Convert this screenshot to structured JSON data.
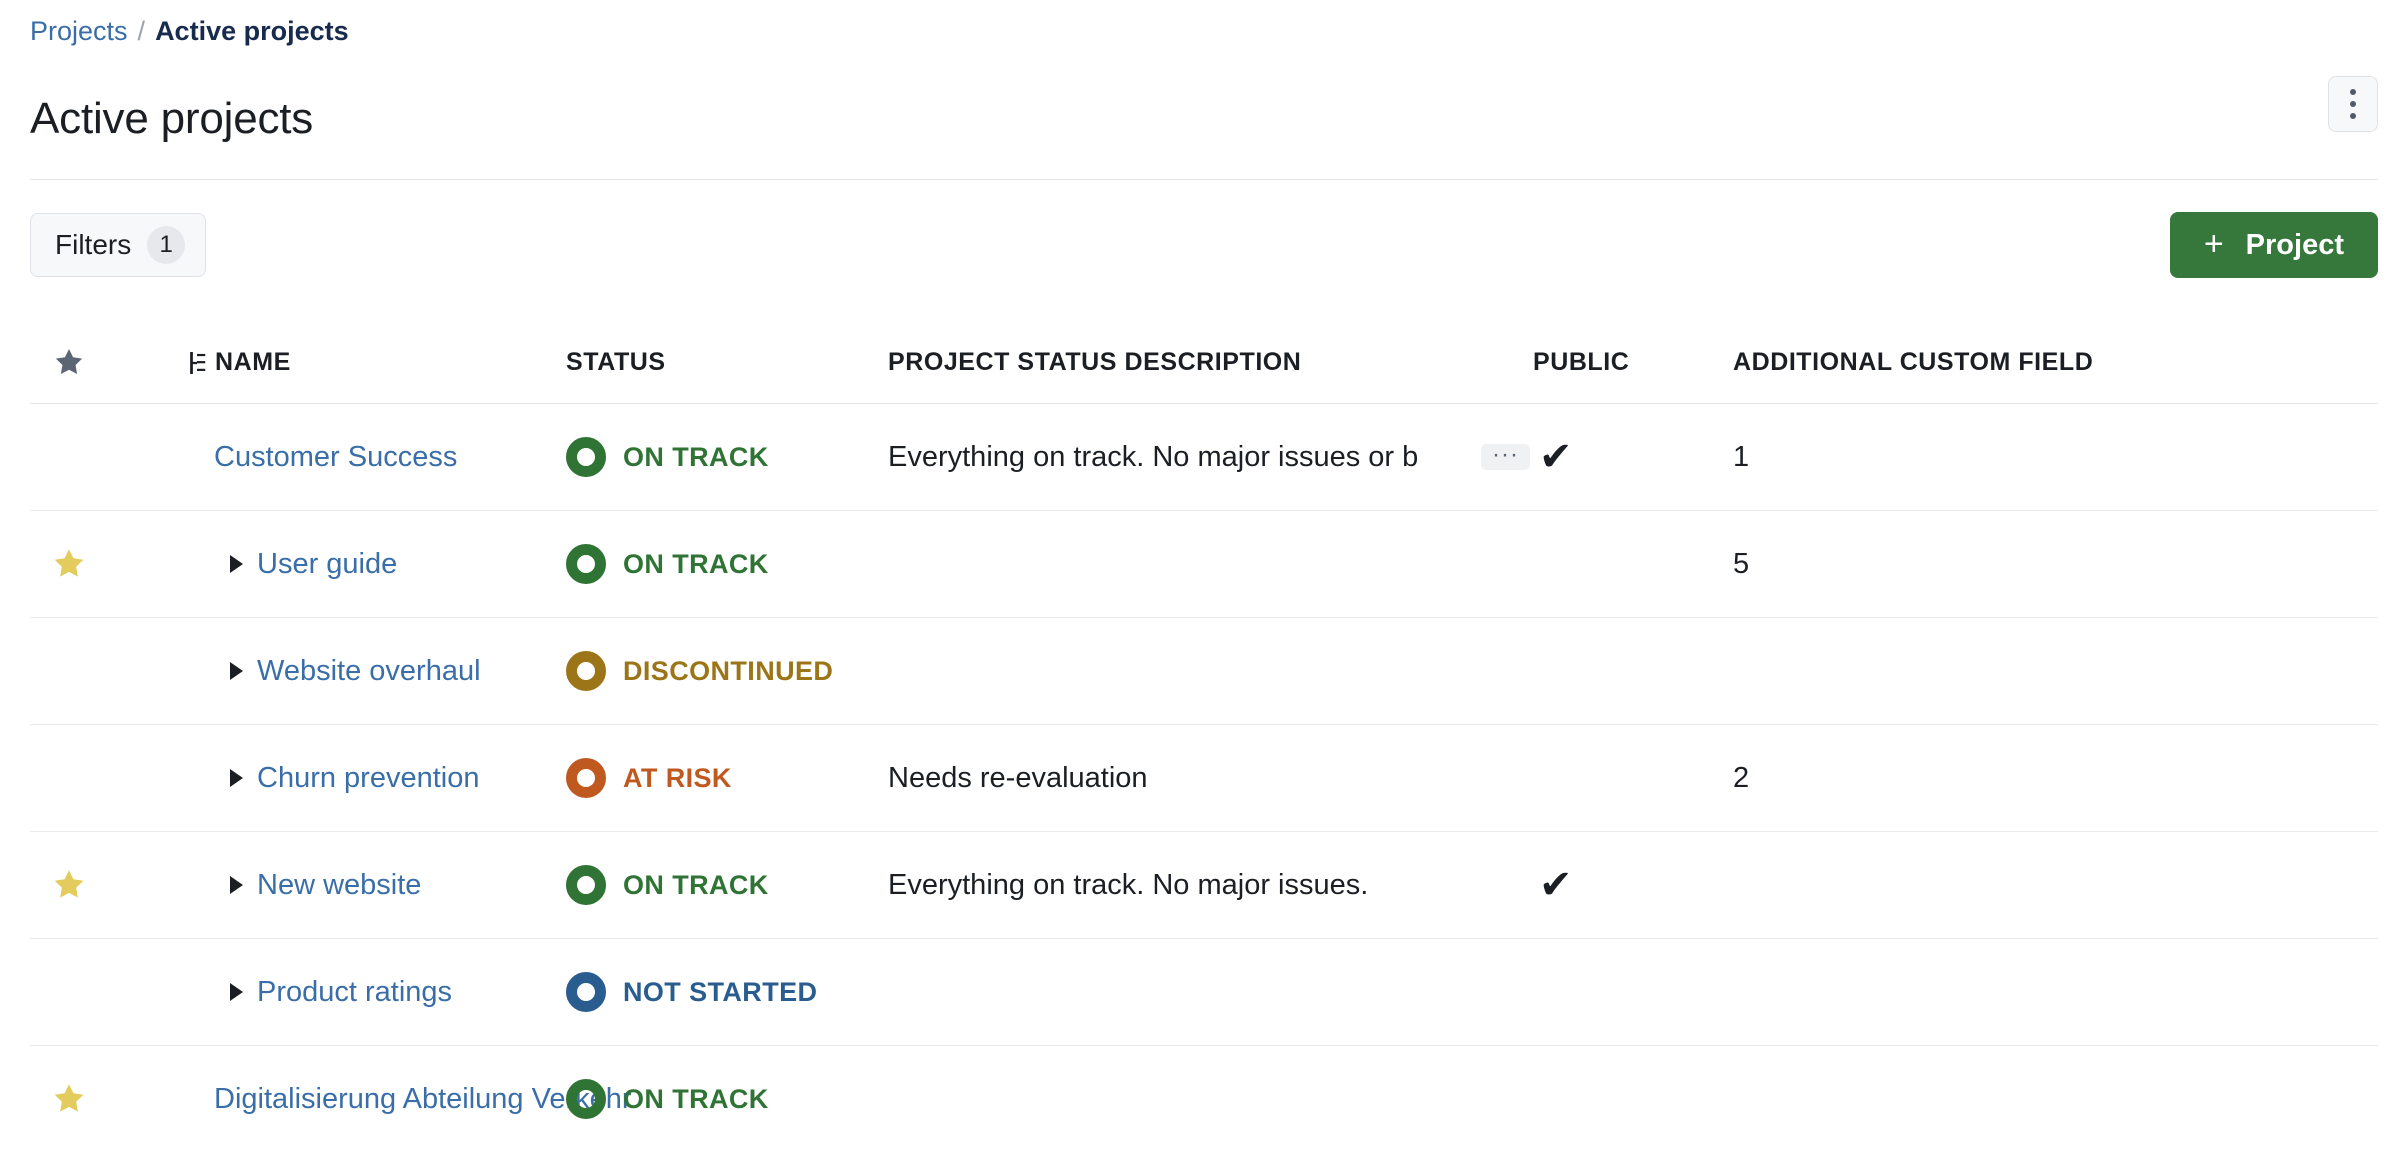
{
  "breadcrumb": {
    "parent": "Projects",
    "separator": "/",
    "current": "Active projects"
  },
  "header": {
    "title": "Active projects",
    "more_actions_icon": "kebab-menu-icon"
  },
  "toolbar": {
    "filters_label": "Filters",
    "filters_count": "1",
    "create_label": "Project",
    "create_plus": "+",
    "create_color": "#36783c"
  },
  "table": {
    "columns": [
      {
        "key": "favorite",
        "label": "",
        "icon": "star-icon"
      },
      {
        "key": "name",
        "label": "NAME",
        "icon": "hierarchy-icon"
      },
      {
        "key": "status",
        "label": "STATUS"
      },
      {
        "key": "description",
        "label": "PROJECT STATUS DESCRIPTION"
      },
      {
        "key": "public",
        "label": "PUBLIC"
      },
      {
        "key": "extra",
        "label": "ADDITIONAL CUSTOM FIELD"
      }
    ],
    "status_colors": {
      "ON TRACK": "#2f7335",
      "DISCONTINUED": "#9c7518",
      "AT RISK": "#c0591f",
      "NOT STARTED": "#2a5d8f"
    },
    "favorite_color": "#e3cc5d",
    "link_color": "#3a6ea8",
    "rows": [
      {
        "favorite": false,
        "level": 0,
        "expandable": false,
        "name": "Customer Success",
        "status": "ON TRACK",
        "description": "Everything on track. No major issues or b",
        "description_truncated": true,
        "overflow_label": "···",
        "public": true,
        "extra": "1"
      },
      {
        "favorite": true,
        "level": 1,
        "expandable": true,
        "name": "User guide",
        "status": "ON TRACK",
        "description": "",
        "description_truncated": false,
        "public": false,
        "extra": "5"
      },
      {
        "favorite": false,
        "level": 1,
        "expandable": true,
        "name": "Website overhaul",
        "status": "DISCONTINUED",
        "description": "",
        "description_truncated": false,
        "public": false,
        "extra": ""
      },
      {
        "favorite": false,
        "level": 1,
        "expandable": true,
        "name": "Churn prevention",
        "status": "AT RISK",
        "description": "Needs re-evaluation",
        "description_truncated": false,
        "public": false,
        "extra": "2"
      },
      {
        "favorite": true,
        "level": 1,
        "expandable": true,
        "name": "New website",
        "status": "ON TRACK",
        "description": "Everything on track. No major issues.",
        "description_truncated": false,
        "public": true,
        "extra": ""
      },
      {
        "favorite": false,
        "level": 1,
        "expandable": true,
        "name": "Product ratings",
        "status": "NOT STARTED",
        "description": "",
        "description_truncated": false,
        "public": false,
        "extra": ""
      },
      {
        "favorite": true,
        "level": 0,
        "expandable": false,
        "name": "Digitalisierung Abteilung Verkehr",
        "status": "ON TRACK",
        "description": "",
        "description_truncated": false,
        "public": false,
        "extra": ""
      }
    ]
  },
  "icons": {
    "check": "✔"
  }
}
